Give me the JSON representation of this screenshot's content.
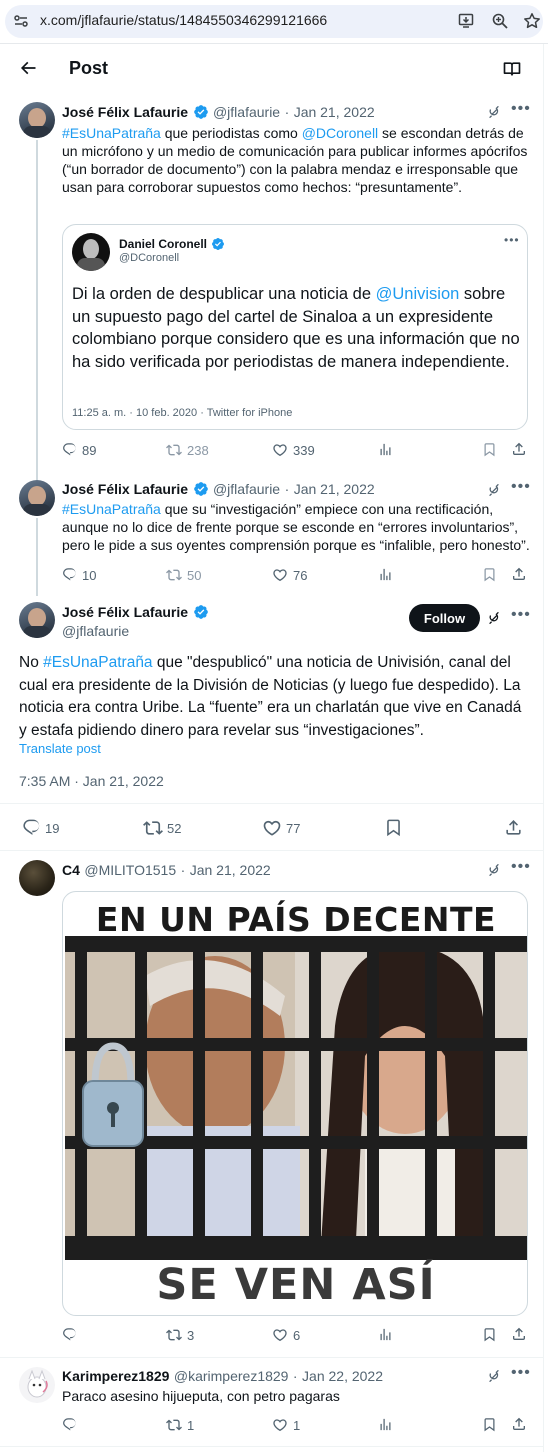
{
  "browser": {
    "url": "x.com/jflafaurie/status/1484550346299121666"
  },
  "header": {
    "title": "Post"
  },
  "tweet1": {
    "name": "José Félix Lafaurie",
    "handle": "@jflafaurie",
    "dot": "·",
    "date": "Jan 21, 2022",
    "hashtag": "#EsUnaPatraña",
    "text_a": " que periodistas como ",
    "mention": "@DCoronell",
    "text_b": " se escondan detrás de un micrófono y un medio de comunicación para publicar informes apócrifos (“un borrador de documento”) con la palabra mendaz e irresponsable que usan para corroborar supuestos como hechos: “presuntamente”.",
    "quote": {
      "name": "Daniel Coronell",
      "handle": "@DCoronell",
      "text_a": "Di la orden de despublicar una noticia de ",
      "mention": "@Univision",
      "text_b": " sobre un supuesto pago del cartel de Sinaloa a un expresidente colombiano porque considero que es una información que no ha sido verificada por periodistas de manera independiente.",
      "meta": "11:25 a. m. · 10 feb. 2020 · Twitter for iPhone"
    },
    "replies": "89",
    "reposts": "238",
    "likes": "339"
  },
  "tweet2": {
    "name": "José Félix Lafaurie",
    "handle": "@jflafaurie",
    "dot": "·",
    "date": "Jan 21, 2022",
    "hashtag": "#EsUnaPatraña",
    "text": " que su “investigación” empiece con una rectificación, aunque no lo dice de frente porque se esconde en “errores involuntarios”, pero le pide a sus oyentes comprensión porque es “infalible, pero honesto”.",
    "replies": "10",
    "reposts": "50",
    "likes": "76"
  },
  "main": {
    "name": "José Félix Lafaurie",
    "handle": "@jflafaurie",
    "follow": "Follow",
    "text_a": "No ",
    "hashtag": "#EsUnaPatraña",
    "text_b": " que \"despublicó\" una noticia de Univisión, canal del cual era presidente de la División de Noticias (y luego fue despedido). La noticia era contra Uribe. La “fuente” era un charlatán que vive en Canadá y estafa pidiendo dinero para revelar sus “investigaciones”.",
    "translate": "Translate post",
    "timestamp": "7:35 AM · Jan 21, 2022",
    "replies": "19",
    "reposts": "52",
    "likes": "77"
  },
  "reply1": {
    "name": "C4",
    "handle": "@MILITO1515",
    "dot": "·",
    "date": "Jan 21, 2022",
    "image_top": "EN UN PAÍS DECENTE",
    "image_bottom": "SE VEN ASÍ",
    "replies": "",
    "reposts": "3",
    "likes": "6"
  },
  "reply2": {
    "name": "Karimperez1829",
    "handle": "@karimperez1829",
    "dot": "·",
    "date": "Jan 22, 2022",
    "text": "Paraco asesino hijueputa, con petro pagaras",
    "replies": "",
    "reposts": "1",
    "likes": "1"
  },
  "colors": {
    "accent": "#1d9bf0",
    "text": "#0f1419",
    "muted": "#536471",
    "border": "#cfd9de"
  }
}
